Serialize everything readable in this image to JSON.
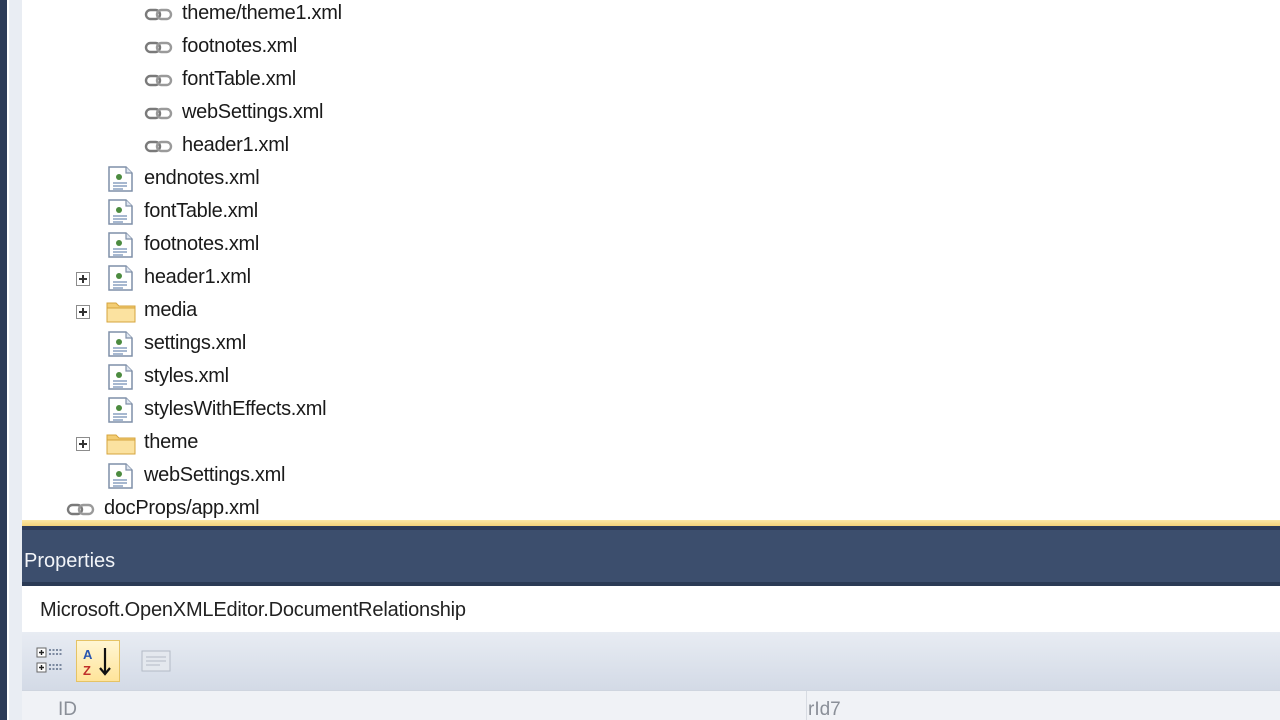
{
  "tree": {
    "rows": [
      {
        "label": "theme/theme1.xml",
        "icon": "link-icon"
      },
      {
        "label": "footnotes.xml",
        "icon": "link-icon"
      },
      {
        "label": "fontTable.xml",
        "icon": "link-icon"
      },
      {
        "label": "webSettings.xml",
        "icon": "link-icon"
      },
      {
        "label": "header1.xml",
        "icon": "link-icon"
      },
      {
        "label": "endnotes.xml",
        "icon": "xml-file-icon"
      },
      {
        "label": "fontTable.xml",
        "icon": "xml-file-icon"
      },
      {
        "label": "footnotes.xml",
        "icon": "xml-file-icon"
      },
      {
        "label": "header1.xml",
        "icon": "xml-file-icon",
        "expandable": true
      },
      {
        "label": "media",
        "icon": "folder-icon",
        "expandable": true
      },
      {
        "label": "settings.xml",
        "icon": "xml-file-icon"
      },
      {
        "label": "styles.xml",
        "icon": "xml-file-icon"
      },
      {
        "label": "stylesWithEffects.xml",
        "icon": "xml-file-icon"
      },
      {
        "label": "theme",
        "icon": "folder-icon",
        "expandable": true
      },
      {
        "label": "webSettings.xml",
        "icon": "xml-file-icon"
      },
      {
        "label": "docProps/app.xml",
        "icon": "link-icon"
      }
    ]
  },
  "properties": {
    "title": "Properties",
    "object_name": "Microsoft.OpenXMLEditor.DocumentRelationship",
    "toolbar": {
      "categorized_icon": "categorized-icon",
      "alphabetical_icon": "sort-az-icon",
      "property_pages_icon": "property-pages-icon"
    },
    "grid": {
      "rows": [
        {
          "name": "ID",
          "value": "rId7"
        }
      ]
    }
  }
}
